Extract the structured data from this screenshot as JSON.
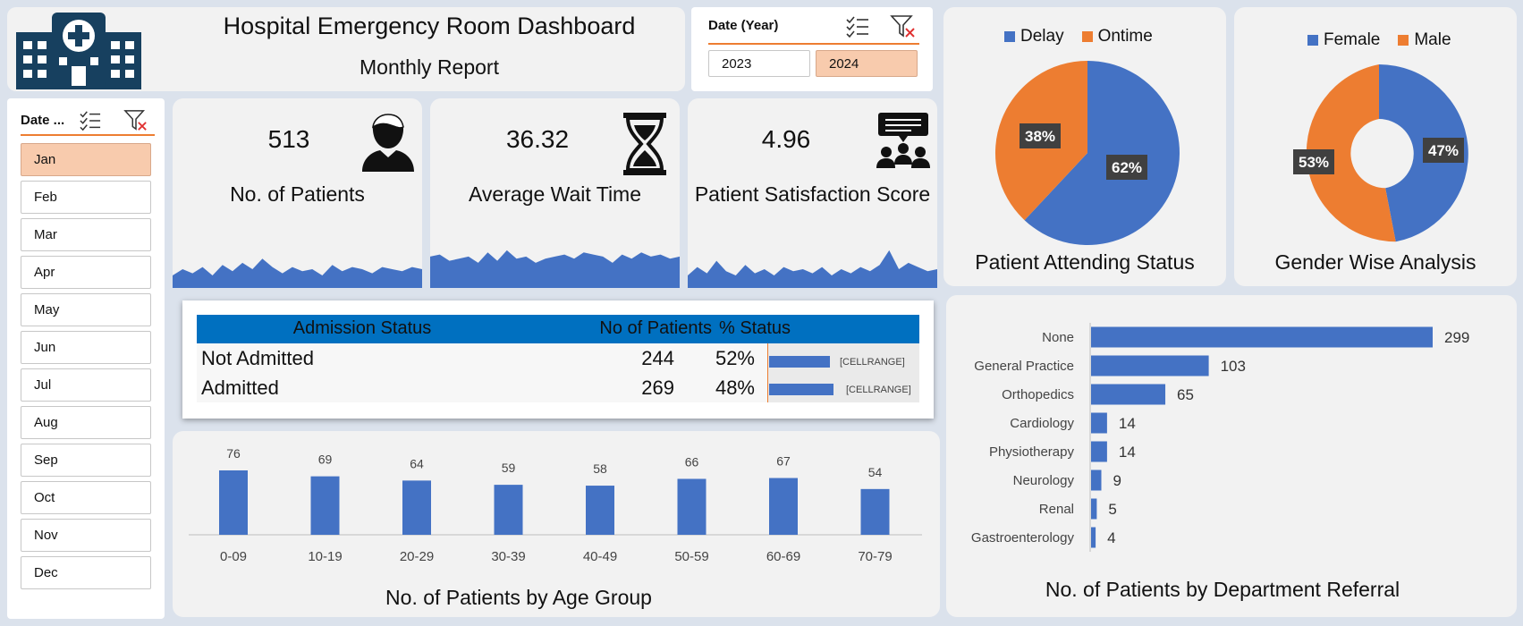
{
  "header": {
    "title": "Hospital Emergency Room Dashboard",
    "subtitle": "Monthly Report",
    "logo_icon": "hospital-icon"
  },
  "year_slicer": {
    "label": "Date (Year)",
    "options": [
      "2023",
      "2024"
    ],
    "selected": "2024"
  },
  "month_slicer": {
    "label": "Date ...",
    "months": [
      "Jan",
      "Feb",
      "Mar",
      "Apr",
      "May",
      "Jun",
      "Jul",
      "Aug",
      "Sep",
      "Oct",
      "Nov",
      "Dec"
    ],
    "selected": "Jan"
  },
  "kpis": [
    {
      "value": "513",
      "label": "No. of Patients",
      "icon": "person-icon",
      "spark": [
        0.3,
        0.45,
        0.35,
        0.5,
        0.3,
        0.55,
        0.4,
        0.6,
        0.45,
        0.7,
        0.5,
        0.35,
        0.5,
        0.4,
        0.45,
        0.3,
        0.55,
        0.4,
        0.5,
        0.45,
        0.35,
        0.5,
        0.45,
        0.4,
        0.5,
        0.45
      ]
    },
    {
      "value": "36.32",
      "label": "Average Wait Time",
      "icon": "hourglass-icon",
      "spark": [
        0.75,
        0.8,
        0.65,
        0.7,
        0.75,
        0.6,
        0.85,
        0.65,
        0.9,
        0.7,
        0.75,
        0.6,
        0.7,
        0.75,
        0.8,
        0.7,
        0.85,
        0.8,
        0.75,
        0.6,
        0.8,
        0.7,
        0.85,
        0.75,
        0.8,
        0.7,
        0.75
      ]
    },
    {
      "value": "4.96",
      "label": "Patient Satisfaction Score",
      "icon": "meeting-icon",
      "spark": [
        0.3,
        0.5,
        0.35,
        0.65,
        0.4,
        0.3,
        0.55,
        0.35,
        0.45,
        0.3,
        0.5,
        0.4,
        0.45,
        0.35,
        0.5,
        0.3,
        0.45,
        0.35,
        0.5,
        0.4,
        0.55,
        0.9,
        0.45,
        0.6,
        0.5,
        0.4,
        0.45
      ]
    }
  ],
  "attending_status": {
    "title": "Patient Attending Status",
    "legend": [
      "Delay",
      "Ontime"
    ],
    "colors": {
      "Delay": "#4472c4",
      "Ontime": "#ed7d31"
    },
    "labels": [
      "62%",
      "38%"
    ]
  },
  "gender": {
    "title": "Gender Wise Analysis",
    "legend": [
      "Female",
      "Male"
    ],
    "colors": {
      "Female": "#4472c4",
      "Male": "#ed7d31"
    },
    "labels": [
      "47%",
      "53%"
    ]
  },
  "admission": {
    "headers": [
      "Admission Status",
      "No of Patients",
      "% Status"
    ],
    "rows": [
      {
        "status": "Not Admitted",
        "count": "244",
        "pct": "52%",
        "bar_label": "[CELLRANGE]",
        "bar_fraction": 0.52
      },
      {
        "status": "Admitted",
        "count": "269",
        "pct": "48%",
        "bar_label": "[CELLRANGE]",
        "bar_fraction": 0.55
      }
    ],
    "header_color": "#0070c0"
  },
  "age_chart": {
    "title": "No. of Patients by Age Group",
    "labels": [
      "76",
      "69",
      "64",
      "59",
      "58",
      "66",
      "67",
      "54"
    ]
  },
  "dept_chart": {
    "title": "No. of Patients by Department Referral",
    "labels": [
      "299",
      "103",
      "65",
      "14",
      "14",
      "9",
      "5",
      "4"
    ]
  },
  "chart_data": [
    {
      "type": "pie",
      "categories": [
        "Delay",
        "Ontime"
      ],
      "values": [
        62,
        38
      ],
      "title": "Patient Attending Status",
      "legend": "top"
    },
    {
      "type": "pie",
      "categories": [
        "Female",
        "Male"
      ],
      "values": [
        47,
        53
      ],
      "title": "Gender Wise Analysis",
      "legend": "top"
    },
    {
      "type": "bar",
      "categories": [
        "0-09",
        "10-19",
        "20-29",
        "30-39",
        "40-49",
        "50-59",
        "60-69",
        "70-79"
      ],
      "values": [
        76,
        69,
        64,
        59,
        58,
        66,
        67,
        54
      ],
      "title": "No. of Patients by Age Group",
      "color": "#4472c4"
    },
    {
      "type": "bar",
      "orientation": "horizontal",
      "categories": [
        "None",
        "General Practice",
        "Orthopedics",
        "Cardiology",
        "Physiotherapy",
        "Neurology",
        "Renal",
        "Gastroenterology"
      ],
      "values": [
        299,
        103,
        65,
        14,
        14,
        9,
        5,
        4
      ],
      "title": "No. of Patients by Department Referral",
      "color": "#4472c4"
    }
  ]
}
